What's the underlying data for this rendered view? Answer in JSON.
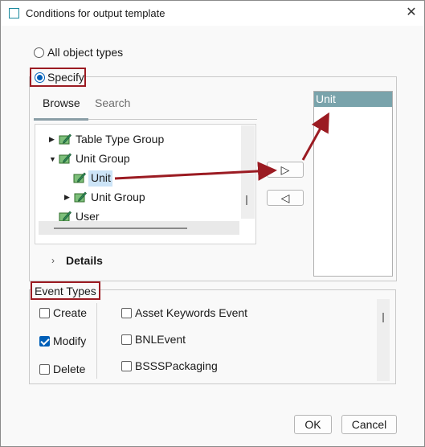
{
  "window": {
    "title": "Conditions for output template",
    "close_glyph": "✕"
  },
  "object_types": {
    "all_label": "All object types",
    "specify_label": "Specify",
    "selected": "Specify"
  },
  "tabs": [
    {
      "label": "Browse",
      "active": true
    },
    {
      "label": "Search",
      "active": false
    }
  ],
  "tree": {
    "items": [
      {
        "label": "Table Type Group",
        "expanded": false,
        "level": 1
      },
      {
        "label": "Unit Group",
        "expanded": true,
        "level": 1
      },
      {
        "label": "Unit",
        "selected": true,
        "level": 2
      },
      {
        "label": "Unit Group",
        "expanded": false,
        "level": 2
      },
      {
        "label": "User",
        "level": 1
      }
    ]
  },
  "details": {
    "label": "Details"
  },
  "selected_list": {
    "header": "Unit"
  },
  "move_buttons": {
    "add_glyph": "▷",
    "remove_glyph": "◁"
  },
  "event_types": {
    "title": "Event Types",
    "actions": [
      {
        "label": "Create",
        "checked": false
      },
      {
        "label": "Modify",
        "checked": true
      },
      {
        "label": "Delete",
        "checked": false
      }
    ],
    "events": [
      {
        "label": "Asset Keywords Event",
        "checked": false
      },
      {
        "label": "BNLEvent",
        "checked": false
      },
      {
        "label": "BSSSPackaging",
        "checked": false
      }
    ]
  },
  "footer": {
    "ok_label": "OK",
    "cancel_label": "Cancel"
  },
  "colors": {
    "highlight_red": "#9b1b22",
    "accent_blue": "#005fb8",
    "list_header_bg": "#79a3ab",
    "selection_bg": "#cce4f7"
  }
}
